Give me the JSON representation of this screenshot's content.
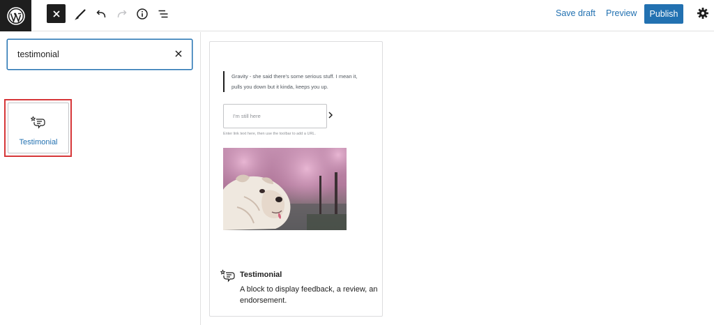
{
  "toolbar": {
    "save_draft": "Save draft",
    "preview": "Preview",
    "publish": "Publish",
    "icons": [
      "wordpress-logo",
      "close-icon",
      "pencil-icon",
      "undo-icon",
      "redo-icon",
      "info-icon",
      "list-view-icon",
      "gear-icon"
    ]
  },
  "inserter": {
    "search_value": "testimonial",
    "results": [
      {
        "label": "Testimonial",
        "icon": "testimonial-icon"
      }
    ]
  },
  "block_preview": {
    "quote": "Gravity - she said there's some serious stuff. I mean it, pulls you down but it kinda, keeps you up.",
    "link_placeholder": "I'm still here",
    "link_hint": "Enter link text here, then use the toolbar to add a URL.",
    "image": "bulldog-under-cherry-blossoms",
    "title": "Testimonial",
    "description": "A block to display feedback, a review, an endorsement."
  },
  "colors": {
    "accent": "#2271b1",
    "highlight": "#d63638",
    "dark": "#1e1e1e"
  }
}
